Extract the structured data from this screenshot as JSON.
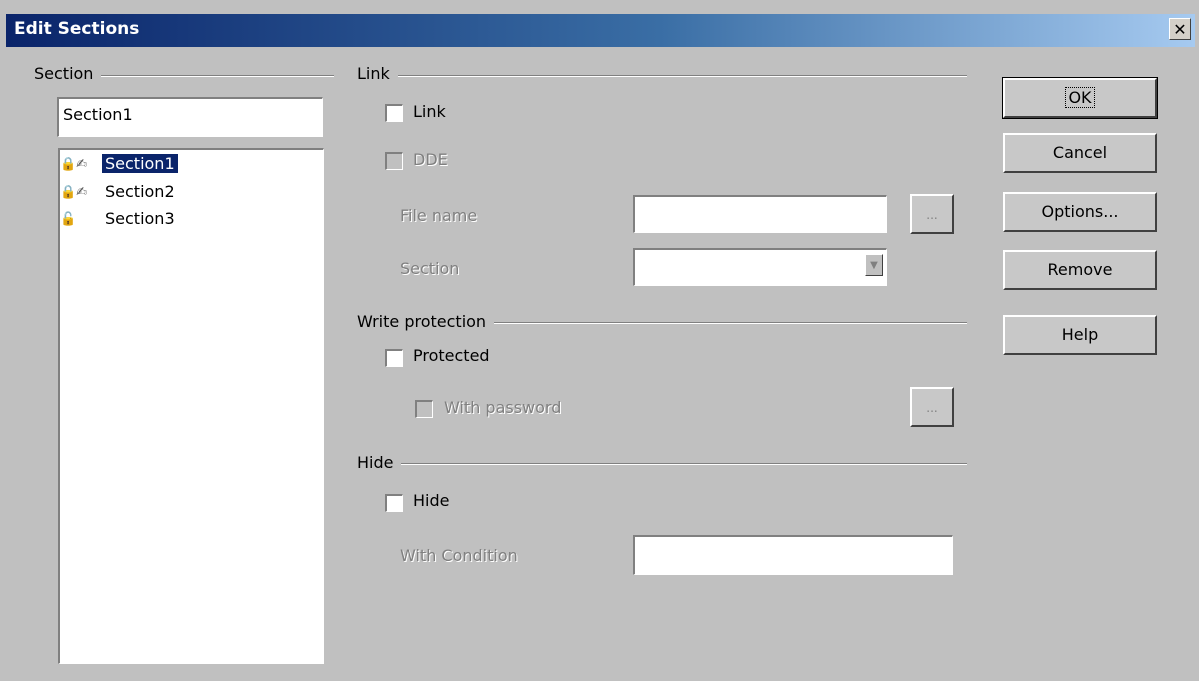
{
  "window": {
    "title": "Edit Sections",
    "close_glyph": "✕"
  },
  "section_group": {
    "label": "Section",
    "name_value": "Section1",
    "items": [
      {
        "label": "Section1",
        "icons": "🔒✍",
        "selected": true
      },
      {
        "label": "Section2",
        "icons": "🔒✍",
        "selected": false
      },
      {
        "label": "Section3",
        "icons": "🔓",
        "selected": false
      }
    ]
  },
  "link_group": {
    "label": "Link",
    "link_checkbox_label": "Link",
    "dde_checkbox_label": "DDE",
    "file_name_label": "File name",
    "file_name_value": "",
    "browse_label": "...",
    "section_label": "Section",
    "section_value": ""
  },
  "write_protection_group": {
    "label": "Write protection",
    "protected_label": "Protected",
    "with_password_label": "With password",
    "password_button_label": "..."
  },
  "hide_group": {
    "label": "Hide",
    "hide_label": "Hide",
    "with_condition_label": "With Condition",
    "condition_value": ""
  },
  "buttons": {
    "ok": "OK",
    "cancel": "Cancel",
    "options": "Options...",
    "remove": "Remove",
    "help": "Help"
  }
}
